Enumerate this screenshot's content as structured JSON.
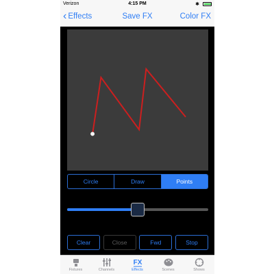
{
  "status_bar": {
    "carrier": "Verizon",
    "time": "4:15 PM"
  },
  "nav": {
    "back_label": "Effects",
    "title": "Save FX",
    "right_label": "Color FX"
  },
  "canvas": {
    "line_color": "#cc1f1f",
    "start_dot_color": "#f2f2f2",
    "points": [
      [
        0.18,
        0.74
      ],
      [
        0.24,
        0.34
      ],
      [
        0.51,
        0.71
      ],
      [
        0.56,
        0.28
      ],
      [
        0.84,
        0.62
      ]
    ]
  },
  "mode_segment": {
    "options": [
      "Circle",
      "Draw",
      "Points"
    ],
    "selected": "Points"
  },
  "speed_slider": {
    "value": 0.5
  },
  "buttons": {
    "clear": "Clear",
    "close": "Close",
    "fwd": "Fwd",
    "stop": "Stop"
  },
  "tabs": [
    {
      "label": "Fixtures",
      "icon": "fixtures-icon"
    },
    {
      "label": "Channels",
      "icon": "channels-icon"
    },
    {
      "label": "Effects",
      "icon": "fx-icon",
      "active": true
    },
    {
      "label": "Scenes",
      "icon": "palette-icon"
    },
    {
      "label": "Shows",
      "icon": "shows-icon"
    }
  ],
  "accent_color": "#2f7ef5"
}
